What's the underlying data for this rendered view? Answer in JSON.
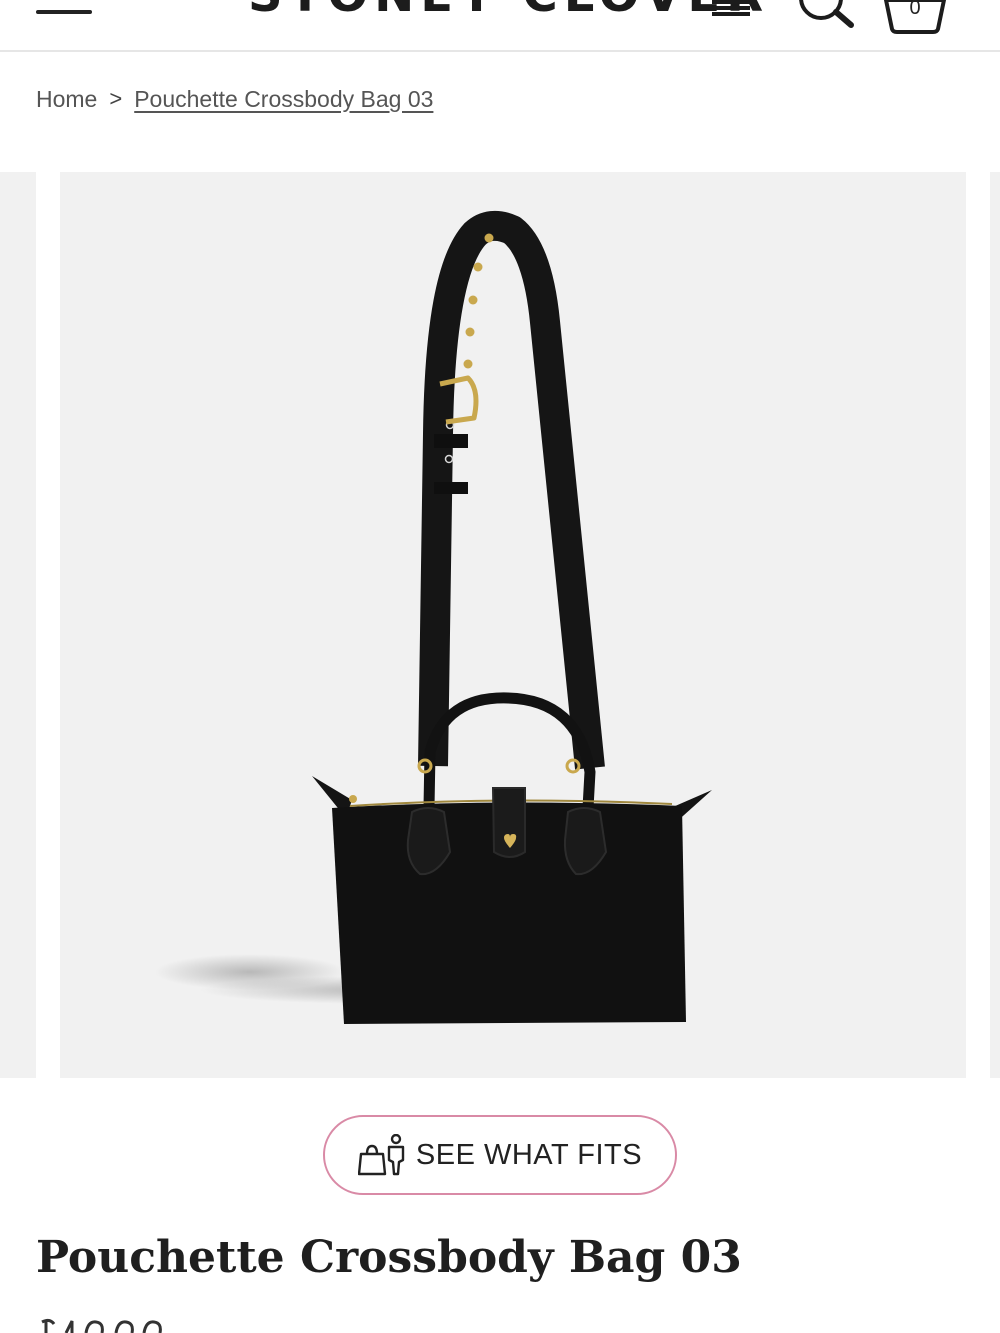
{
  "header": {
    "brand": "STONEY CLOVER",
    "cart_count": "0",
    "menu_icon": "hamburger-icon",
    "search_icon": "search-icon",
    "cart_icon": "bag-icon"
  },
  "breadcrumb": {
    "home": "Home",
    "separator": ">",
    "current": "Pouchette Crossbody Bag 03"
  },
  "gallery": {
    "image_alt": "Pouchette Crossbody Bag 03"
  },
  "fit_button": {
    "label": "SEE WHAT FITS",
    "icon": "bag-and-person-icon"
  },
  "product": {
    "title": "Pouchette Crossbody Bag 03"
  },
  "colors": {
    "accent_border": "#d98aa6",
    "gallery_bg": "#f1f1f1",
    "text": "#1f1f1f"
  }
}
